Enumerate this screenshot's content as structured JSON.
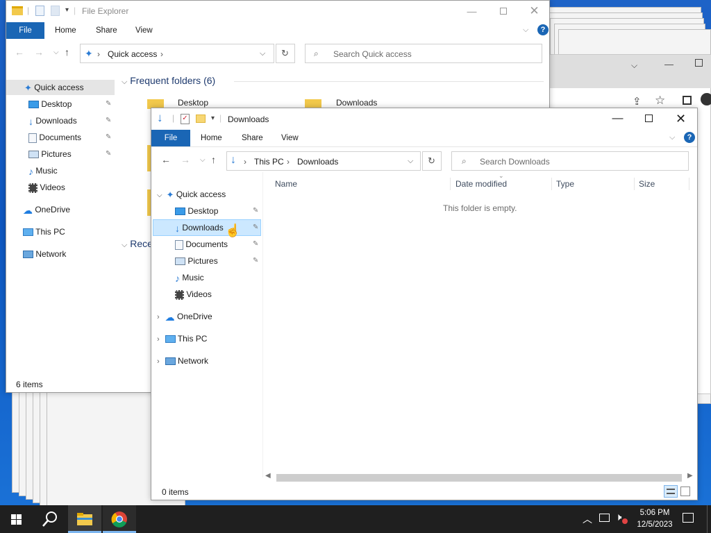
{
  "background_window": {
    "title": "File Explorer",
    "ribbon_tabs": [
      "File",
      "Home",
      "Share",
      "View"
    ],
    "address_crumbs": [
      "Quick access"
    ],
    "search_placeholder": "Search Quick access",
    "nav_items": [
      {
        "label": "Quick access",
        "icon": "star-icon"
      },
      {
        "label": "Desktop",
        "icon": "desktop-icon",
        "pinned": true
      },
      {
        "label": "Downloads",
        "icon": "download-arrow-icon",
        "pinned": true
      },
      {
        "label": "Documents",
        "icon": "document-icon",
        "pinned": true
      },
      {
        "label": "Pictures",
        "icon": "picture-icon",
        "pinned": true
      },
      {
        "label": "Music",
        "icon": "music-note-icon"
      },
      {
        "label": "Videos",
        "icon": "film-icon"
      },
      {
        "label": "OneDrive",
        "icon": "cloud-icon"
      },
      {
        "label": "This PC",
        "icon": "monitor-icon"
      },
      {
        "label": "Network",
        "icon": "network-icon"
      }
    ],
    "frequent_header": "Frequent folders (6)",
    "frequent_folders": [
      "Desktop",
      "Downloads"
    ],
    "recent_header_partial": "Rece",
    "status": "6 items"
  },
  "front_window": {
    "title": "Downloads",
    "ribbon_tabs": [
      "File",
      "Home",
      "Share",
      "View"
    ],
    "address_crumbs": [
      "This PC",
      "Downloads"
    ],
    "search_placeholder": "Search Downloads",
    "columns": [
      "Name",
      "Date modified",
      "Type",
      "Size"
    ],
    "empty_message": "This folder is empty.",
    "status": "0 items",
    "nav": {
      "quick_access": "Quick access",
      "quick_items": [
        {
          "label": "Desktop",
          "icon": "desktop-icon",
          "pinned": true
        },
        {
          "label": "Downloads",
          "icon": "download-arrow-icon",
          "pinned": true,
          "selected": true
        },
        {
          "label": "Documents",
          "icon": "document-icon",
          "pinned": true
        },
        {
          "label": "Pictures",
          "icon": "picture-icon",
          "pinned": true
        },
        {
          "label": "Music",
          "icon": "music-note-icon"
        },
        {
          "label": "Videos",
          "icon": "film-icon"
        }
      ],
      "roots": [
        {
          "label": "OneDrive",
          "icon": "cloud-icon"
        },
        {
          "label": "This PC",
          "icon": "monitor-icon"
        },
        {
          "label": "Network",
          "icon": "network-icon"
        }
      ]
    }
  },
  "taskbar": {
    "time": "5:06 PM",
    "date": "12/5/2023"
  },
  "colors": {
    "accent": "#1a66b5",
    "selection": "#cce8ff",
    "taskbar": "#1f1f1f",
    "desktop": "#1565c0"
  }
}
